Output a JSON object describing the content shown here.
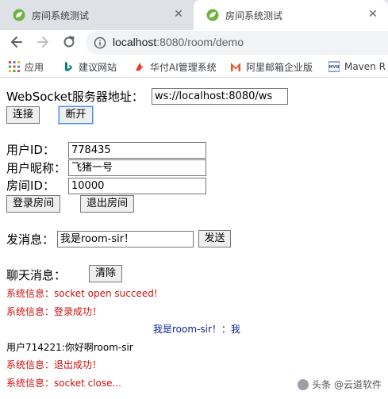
{
  "browser": {
    "tabs": [
      {
        "title": "房间系统测试",
        "active": false
      },
      {
        "title": "房间系统测试",
        "active": true
      }
    ],
    "url": {
      "host": "localhost",
      "rest": ":8080/room/demo"
    },
    "bookmarks": [
      {
        "label": "应用",
        "icon": "apps-grid-icon"
      },
      {
        "label": "建议网站",
        "icon": "bing-icon"
      },
      {
        "label": "华付AI管理系统",
        "icon": "huafu-logo-icon"
      },
      {
        "label": "阿里邮箱企业版",
        "icon": "alimail-icon"
      },
      {
        "label": "Maven R",
        "icon": "mvn-icon"
      }
    ]
  },
  "page": {
    "ws": {
      "label": "WebSocket服务器地址：",
      "value": "ws://localhost:8080/ws"
    },
    "connect_label": "连接",
    "disconnect_label": "断开",
    "user_id": {
      "label": "用户ID：",
      "value": "778435"
    },
    "nickname": {
      "label": "用户昵称：",
      "value": "飞猪一号"
    },
    "room_id": {
      "label": "房间ID：",
      "value": "10000"
    },
    "login_room_label": "登录房间",
    "exit_room_label": "退出房间",
    "send": {
      "label": "发消息：",
      "value": "我是room-sir！",
      "button": "发送"
    },
    "chat": {
      "label": "聊天消息：",
      "clear_label": "清除"
    },
    "messages": [
      {
        "type": "sys",
        "text": "系统信息：socket open succeed!"
      },
      {
        "type": "sys",
        "text": "系统信息：登录成功！"
      },
      {
        "type": "me",
        "text": "我是room-sir！：我"
      },
      {
        "type": "other",
        "text": "用户714221:你好啊room-sir"
      },
      {
        "type": "sys",
        "text": "系统信息：退出成功！"
      },
      {
        "type": "sys",
        "text": "系统信息：socket close..."
      }
    ]
  },
  "watermark": "头条 @云道软件",
  "colors": {
    "system_message": "#cc1111",
    "own_message": "#0d1f99",
    "tab_strip": "#dee1e6",
    "omnibox": "#f1f3f4"
  }
}
